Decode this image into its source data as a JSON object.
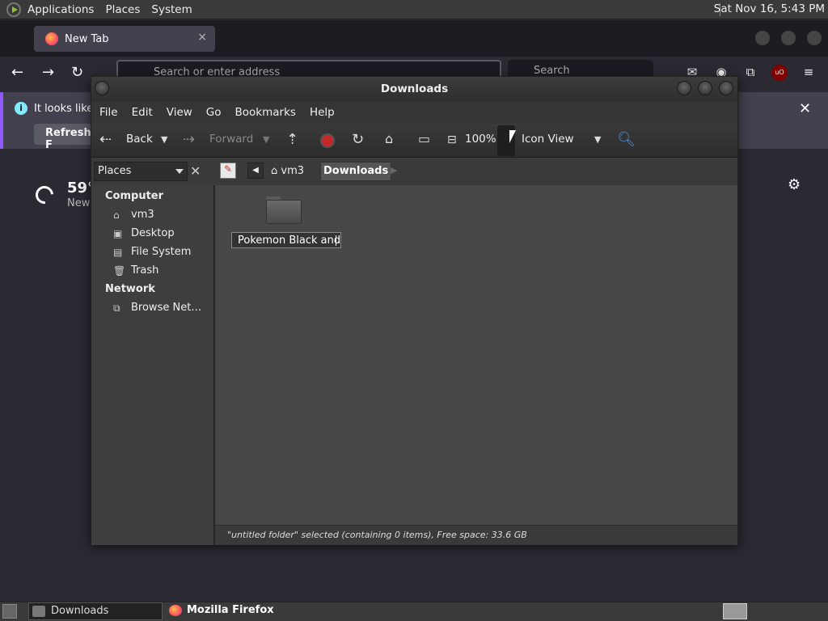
{
  "top_panel": {
    "menus": [
      "Applications",
      "Places",
      "System"
    ],
    "clock": "Sat Nov 16,  5:43 PM"
  },
  "firefox": {
    "tab_title": "New Tab",
    "tab_close": "×",
    "url_placeholder": "Search or enter address",
    "search_placeholder": "Search",
    "notice_text": "It looks like",
    "refresh_label": "Refresh F",
    "notice_close": "✕",
    "weather_temp": "59°",
    "weather_loc": "New"
  },
  "window": {
    "title": "Downloads",
    "menus": [
      "File",
      "Edit",
      "View",
      "Go",
      "Bookmarks",
      "Help"
    ],
    "toolbar": {
      "back": "Back",
      "forward": "Forward",
      "zoom": "100%",
      "view_mode": "Icon View"
    },
    "sidebar_combo": "Places",
    "breadcrumb": {
      "parent": "vm3",
      "current": "Downloads"
    },
    "sidebar": {
      "computer_heading": "Computer",
      "computer_items": [
        "vm3",
        "Desktop",
        "File System",
        "Trash"
      ],
      "network_heading": "Network",
      "network_items": [
        "Browse Net…"
      ]
    },
    "file": {
      "rename_value": "Pokemon Black and"
    },
    "status": "\"untitled folder\" selected (containing 0 items), Free space: 33.6 GB"
  },
  "taskbar": {
    "downloads": "Downloads",
    "firefox": "Mozilla Firefox"
  }
}
